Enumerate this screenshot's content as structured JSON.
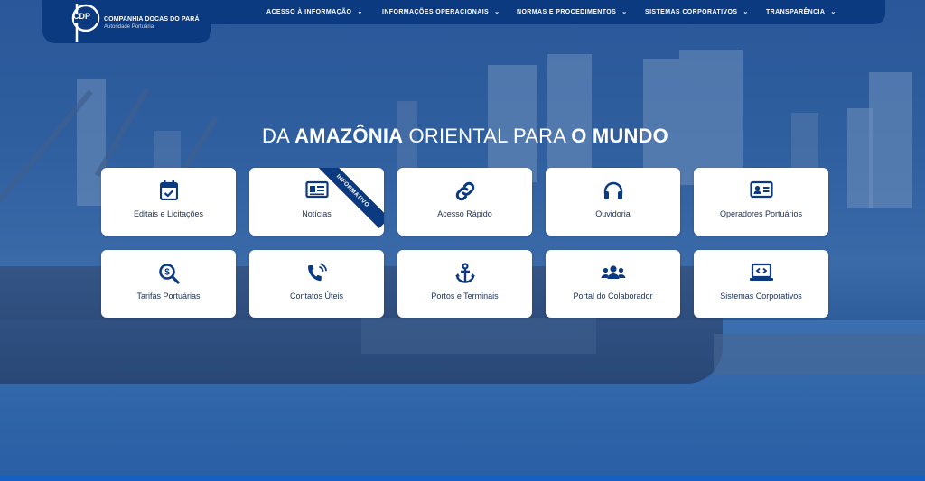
{
  "brand": {
    "logo_text": "CDP",
    "title": "COMPANHIA DOCAS DO PARÁ",
    "subtitle": "Autoridade Portuária"
  },
  "nav": [
    {
      "label": "ACESSO À INFORMAÇÃO"
    },
    {
      "label": "INFORMAÇÕES OPERACIONAIS"
    },
    {
      "label": "NORMAS E PROCEDIMENTOS"
    },
    {
      "label": "SISTEMAS CORPORATIVOS"
    },
    {
      "label": "TRANSPARÊNCIA"
    }
  ],
  "headline": {
    "part1": "DA ",
    "part2": "AMAZÔNIA",
    "part3": " ORIENTAL PARA ",
    "part4": "O MUNDO"
  },
  "cards": [
    {
      "label": "Editais e Licitações",
      "icon": "calendar-check-icon"
    },
    {
      "label": "Notícias",
      "icon": "newspaper-icon",
      "ribbon": "INFORMATIVO"
    },
    {
      "label": "Acesso Rápido",
      "icon": "link-icon"
    },
    {
      "label": "Ouvidoria",
      "icon": "headphones-icon"
    },
    {
      "label": "Operadores Portuários",
      "icon": "id-card-icon"
    },
    {
      "label": "Tarifas Portuárias",
      "icon": "search-dollar-icon"
    },
    {
      "label": "Contatos Úteis",
      "icon": "phone-volume-icon"
    },
    {
      "label": "Portos e Terminais",
      "icon": "anchor-icon"
    },
    {
      "label": "Portal do Colaborador",
      "icon": "users-icon"
    },
    {
      "label": "Sistemas Corporativos",
      "icon": "laptop-code-icon"
    }
  ],
  "colors": {
    "nav_bg": "#0b3a80",
    "icon": "#0b3a80",
    "card_text": "#1b2f55"
  }
}
